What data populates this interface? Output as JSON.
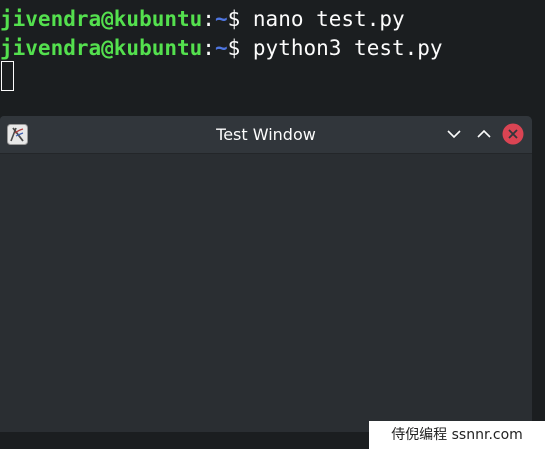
{
  "terminal": {
    "lines": [
      {
        "user": "jivendra@kubuntu",
        "colon": ":",
        "path": "~",
        "dollar": "$",
        "command": " nano test.py"
      },
      {
        "user": "jivendra@kubuntu",
        "colon": ":",
        "path": "~",
        "dollar": "$",
        "command": " python3 test.py"
      }
    ],
    "colors": {
      "background": "#1b1e20",
      "user": "#54e04e",
      "path": "#4f76e0",
      "text": "#fcfcfc"
    }
  },
  "window": {
    "title": "Test Window",
    "app_icon": "tk-feather-icon",
    "buttons": [
      "minimize-chevron-down-icon",
      "maximize-chevron-up-icon",
      "close-x-icon"
    ],
    "close_color": "#da4453"
  },
  "watermark": {
    "text": "侍倪编程 ssnnr.com"
  }
}
